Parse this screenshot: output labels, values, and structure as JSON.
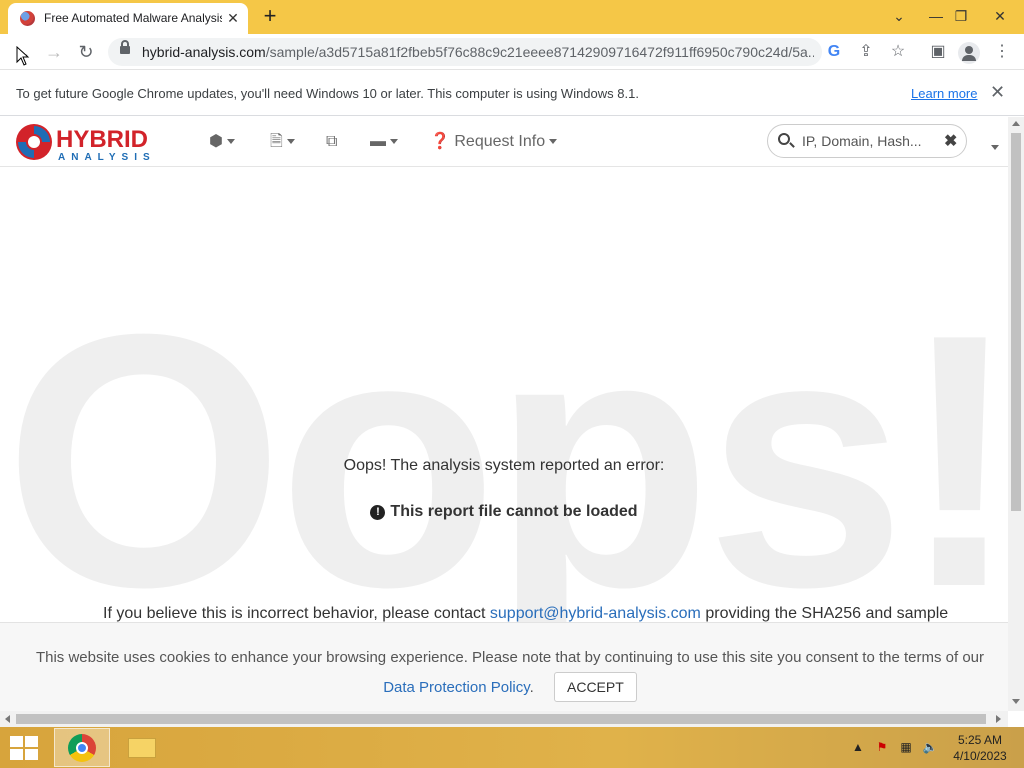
{
  "browser": {
    "tab_title": "Free Automated Malware Analysis",
    "url_host": "hybrid-analysis.com",
    "url_path": "/sample/a3d5715a81f2fbeb5f76c88c9c21eeee87142909716472f911ff6950c790c24d/5a...",
    "infobar_text": "To get future Google Chrome updates, you'll need Windows 10 or later. This computer is using Windows 8.1.",
    "infobar_link": "Learn more"
  },
  "site": {
    "logo_top": "HYBRID",
    "logo_bottom": "ANALYSIS",
    "nav_request_info": "Request Info",
    "search_placeholder": "IP, Domain, Hash..."
  },
  "page": {
    "watermark": "Oops!",
    "error_heading": "Oops! The analysis system reported an error:",
    "error_message": "This report file cannot be loaded",
    "contact_prefix": "If you believe this is incorrect behavior, please contact",
    "contact_email": "support@hybrid-analysis.com",
    "contact_suffix": "providing the SHA256 and sample"
  },
  "cookie": {
    "text": "This website uses cookies to enhance your browsing experience. Please note that by continuing to use this site you consent to the terms of our",
    "link": "Data Protection Policy",
    "period": ".",
    "accept": "ACCEPT"
  },
  "taskbar": {
    "time": "5:25 AM",
    "date": "4/10/2023"
  },
  "colors": {
    "titlebar": "#f5c747",
    "brand_red": "#d2232a",
    "brand_blue": "#1f6db5",
    "link": "#2a6ebb"
  }
}
